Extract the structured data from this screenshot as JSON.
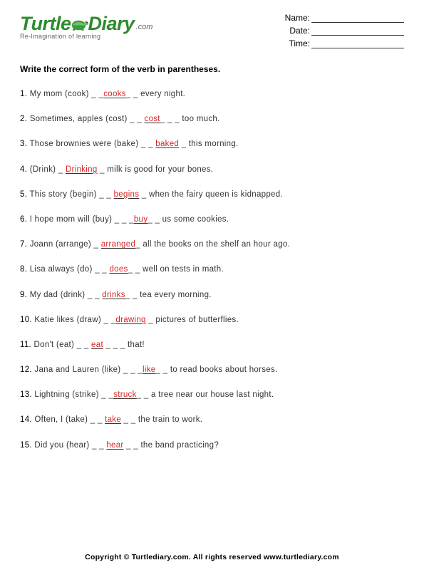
{
  "logo": {
    "word1": "Turtle",
    "word2": "Diary",
    "dotcom": ".com",
    "tagline": "Re-Imagination of learning"
  },
  "fields": [
    {
      "label": "Name:"
    },
    {
      "label": "Date:"
    },
    {
      "label": "Time:"
    }
  ],
  "instruction": "Write the correct form of the verb in parentheses.",
  "questions": [
    {
      "num": "1.",
      "pre": "My mom (cook) _ _",
      "ans": "cooks",
      "post": "_ _ every night."
    },
    {
      "num": "2.",
      "pre": "Sometimes, apples (cost) _ _ ",
      "ans": "cost",
      "post": "_ _ _ too much."
    },
    {
      "num": "3.",
      "pre": "Those brownies were (bake) _ _ ",
      "ans": "baked",
      "post": " _ this morning."
    },
    {
      "num": "4.",
      "pre": "(Drink) _ ",
      "ans": "Drinking",
      "post": " _ milk is good for your bones."
    },
    {
      "num": "5.",
      "pre": "This story (begin) _ _ ",
      "ans": "begins",
      "post": " _ when the fairy queen is kidnapped."
    },
    {
      "num": "6.",
      "pre": "I hope mom will (buy) _ _ _",
      "ans": "buy",
      "post": "_ _ us some cookies."
    },
    {
      "num": "7.",
      "pre": "Joann (arrange) _ ",
      "ans": "arranged",
      "post": "_ all the books on the shelf an hour ago."
    },
    {
      "num": "8.",
      "pre": "Lisa always (do) _ _ ",
      "ans": "does",
      "post": "_ _ well on tests in math."
    },
    {
      "num": "9.",
      "pre": "My dad (drink) _ _ ",
      "ans": "drinks",
      "post": "_ _ tea every morning."
    },
    {
      "num": "10.",
      "pre": "Katie likes (draw) _ _",
      "ans": "drawing",
      "post": " _ pictures of butterflies."
    },
    {
      "num": "11.",
      "pre": "Don't (eat) _ _ ",
      "ans": "eat",
      "post": " _ _ _ that!"
    },
    {
      "num": "12.",
      "pre": "Jana and Lauren (like) _ _ _",
      "ans": "like",
      "post": "_ _ to read books about horses."
    },
    {
      "num": "13.",
      "pre": "Lightning (strike) _ _",
      "ans": "struck",
      "post": "_ _ a tree near our house last night."
    },
    {
      "num": "14.",
      "pre": "Often, I (take) _ _ ",
      "ans": "take",
      "post": " _ _ the train to work."
    },
    {
      "num": "15.",
      "pre": "Did you (hear) _ _ ",
      "ans": "hear",
      "post": " _ _ the band practicing?"
    }
  ],
  "footer": "Copyright © Turtlediary.com. All rights reserved   www.turtlediary.com"
}
